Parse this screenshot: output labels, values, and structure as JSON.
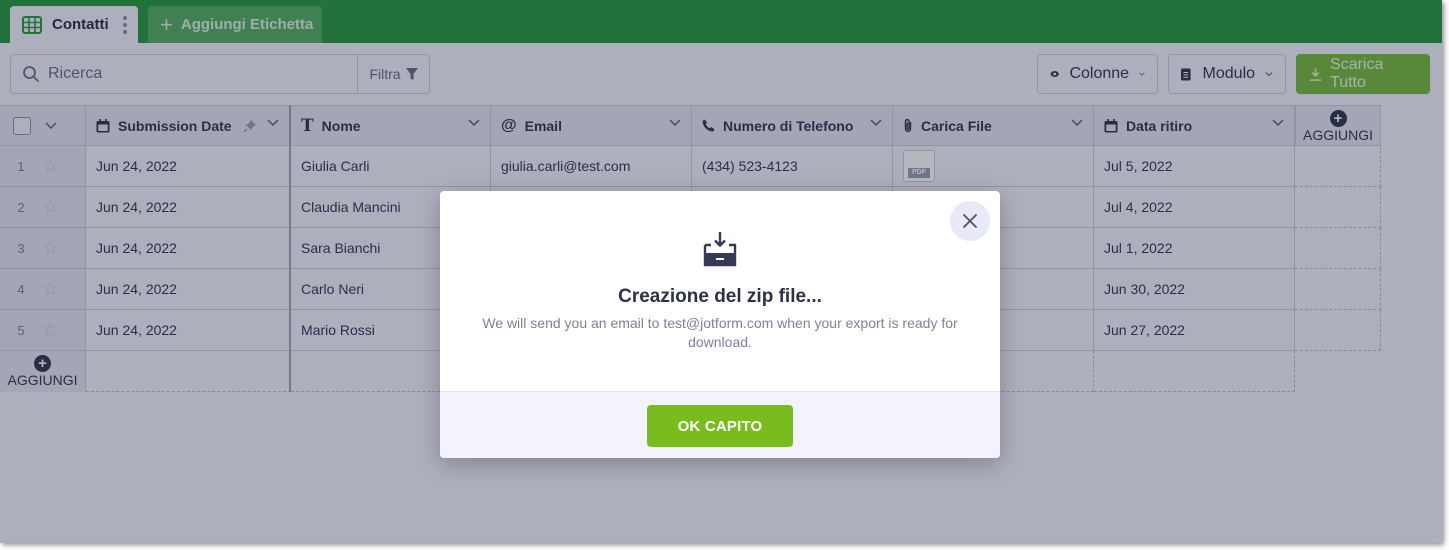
{
  "tabs": {
    "active_label": "Contatti",
    "add_label": "Aggiungi Etichetta"
  },
  "toolbar": {
    "search_placeholder": "Ricerca",
    "filter_label": "Filtra",
    "columns_label": "Colonne",
    "form_label": "Modulo",
    "download_label": "Scarica Tutto"
  },
  "table": {
    "headers": [
      "Submission Date",
      "Nome",
      "Email",
      "Numero di Telefono",
      "Carica File",
      "Data ritiro"
    ],
    "add_column_label": "AGGIUNGI",
    "add_row_label": "AGGIUNGI",
    "rows": [
      {
        "num": "1",
        "date": "Jun 24, 2022",
        "name": "Giulia Carli",
        "email": "giulia.carli@test.com",
        "phone": "(434) 523-4123",
        "file": "PDF",
        "pickup": "Jul 5, 2022"
      },
      {
        "num": "2",
        "date": "Jun 24, 2022",
        "name": "Claudia Mancini",
        "email": "",
        "phone": "",
        "file": "",
        "pickup": "Jul 4, 2022"
      },
      {
        "num": "3",
        "date": "Jun 24, 2022",
        "name": "Sara Bianchi",
        "email": "",
        "phone": "",
        "file": "",
        "pickup": "Jul 1, 2022"
      },
      {
        "num": "4",
        "date": "Jun 24, 2022",
        "name": "Carlo Neri",
        "email": "",
        "phone": "",
        "file": "",
        "pickup": "Jun 30, 2022"
      },
      {
        "num": "5",
        "date": "Jun 24, 2022",
        "name": "Mario Rossi",
        "email": "",
        "phone": "",
        "file": "",
        "pickup": "Jun 27, 2022"
      }
    ]
  },
  "modal": {
    "title": "Creazione del zip file...",
    "description": "We will send you an email to test@jotform.com when your export is ready for download.",
    "ok_label": "OK CAPITO"
  },
  "colors": {
    "brand_green": "#2d9b44",
    "ok_button": "#78bc1e",
    "text_dark": "#343a56"
  }
}
